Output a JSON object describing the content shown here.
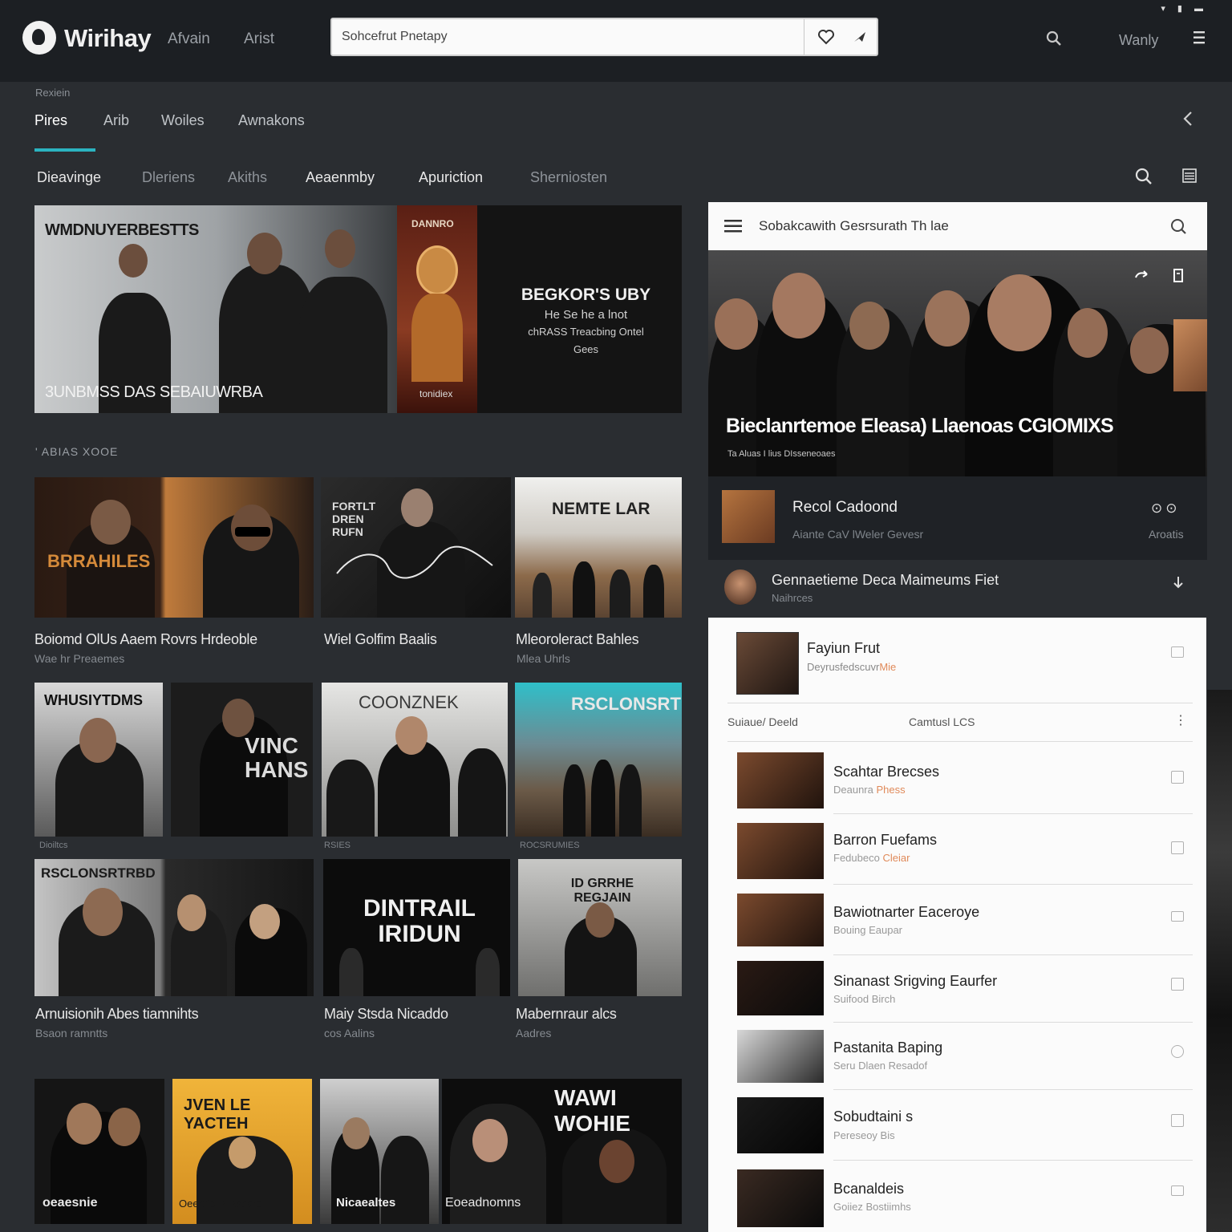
{
  "header": {
    "logo_text": "Wirihay",
    "nav": [
      "Afvain",
      "Arist"
    ],
    "search_placeholder": "Sohcefrut Pnetapy",
    "user_label": "Wanly",
    "status_icons": "▾ ▮ ▬"
  },
  "tabs": {
    "caption": "Rexiein",
    "items": [
      "Pires",
      "Arib",
      "Woiles",
      "Awnakons"
    ],
    "active_index": 0
  },
  "subnav": {
    "items": [
      "Dieavinge",
      "Dleriens",
      "Akiths",
      "Aeaenmby",
      "Apuriction",
      "Sherniosten"
    ],
    "active_index": 0
  },
  "hero": {
    "title": "WMDNUYERBESTTS",
    "caption": "3UNBMSS DAS SEBAIUWRBA",
    "poster_title": "DANNRO",
    "poster_foot": "tonidiex",
    "right_title": "BEGKOR'S UBY",
    "right_lines": [
      "He Se he a lnot",
      "chRASS Treacbing Ontel",
      "Gees"
    ]
  },
  "section_label": "' ABIAS XOOE",
  "albums": [
    {
      "title": "Boiomd OlUs Aaem Rovrs Hrdeoble",
      "sub": "Wae hr Preaemes",
      "art": "BRRAHILES",
      "tag": ""
    },
    {
      "title": "Wiel Golfim Baalis",
      "sub": "",
      "art": "FORTLT DREN RUFN",
      "tag": ""
    },
    {
      "title": "Mleoroleract Bahles",
      "sub": "Mlea Uhrls",
      "art": "NEMTE LAR",
      "tag": ""
    },
    {
      "title": "",
      "sub": "",
      "art": "WHUSIYTDMS",
      "tag": "Dioiltcs"
    },
    {
      "title": "",
      "sub": "",
      "art": "VINC HANS",
      "tag": "RSIES"
    },
    {
      "title": "",
      "sub": "",
      "art": "COONZNEK",
      "tag": "ROCSRUMIES"
    },
    {
      "title": "Arnuisionih Abes tiamnihts",
      "sub": "Bsaon ramntts",
      "art": "RSCLONSRTRBD",
      "tag": ""
    },
    {
      "title": "Maiy Stsda Nicaddo",
      "sub": "cos Aalins",
      "art": "DINTRAIL IRIDUN",
      "tag": ""
    },
    {
      "title": "Mabernraur alcs",
      "sub": "Aadres",
      "art": "ID GRRHE REGJAIN",
      "tag": ""
    },
    {
      "title": "",
      "sub": "",
      "art": "oeaesnie",
      "tag": ""
    },
    {
      "title": "",
      "sub": "",
      "art": "JVEN LE YACTEH",
      "tag": "Oeercie R Rsaaro"
    },
    {
      "title": "",
      "sub": "",
      "art": "Nicaealtes",
      "tag": ""
    },
    {
      "title": "",
      "sub": "",
      "art": "WAWI WOHIE",
      "tag": "Eoeadnomns"
    }
  ],
  "right_panel": {
    "search_text": "Sobakcawith Gesrsurath Th lae",
    "hero_title": "Bieclanrtemoe Eleasa) Llaenoas CGIOMIXS",
    "hero_sub": "Ta Aluas I lius DIsseneoaes",
    "now_playing": {
      "title": "Recol Cadoond",
      "sub": "Aiante CaV lWeler Gevesr",
      "controls": "⊙⊙",
      "meta": "Aroatis"
    },
    "queue": {
      "title": "Gennaetieme Deca Maimeums Fiet",
      "sub": "Naihrces"
    },
    "featured": {
      "title": "Fayiun Frut",
      "sub": "Deyrusfedscuvr",
      "sub_accent": "Mie"
    },
    "columns": [
      "Suiaue/ Deeld",
      "Camtusl LCS"
    ],
    "rows": [
      {
        "title": "Scahtar Brecses",
        "sub": "Deaunra",
        "sub_accent": "Phess",
        "mark": "square"
      },
      {
        "title": "Barron Fuefams",
        "sub": "Fedubeco",
        "sub_accent": "Cleiar",
        "mark": "square"
      },
      {
        "title": "Bawiotnarter Eaceroye",
        "sub": "Bouing Eaupar",
        "sub_accent": "",
        "mark": "list"
      },
      {
        "title": "Sinanast Srigving Eaurfer",
        "sub": "Suifood Birch",
        "sub_accent": "",
        "mark": "square"
      },
      {
        "title": "Pastanita Baping",
        "sub": "Seru Dlaen Resadof",
        "sub_accent": "",
        "mark": "round"
      },
      {
        "title": "Sobudtaini s",
        "sub": "Pereseoy Bis",
        "sub_accent": "",
        "mark": "square"
      },
      {
        "title": "Bcanaldeis",
        "sub": "Goiiez Bostiimhs",
        "sub_accent": "",
        "mark": "list"
      }
    ]
  },
  "colors": {
    "accent": "#2bb3c0",
    "background": "#2a2d31",
    "header": "#1c1f23",
    "panel_light": "#fbfbfb",
    "highlight_text": "#e08a5a"
  }
}
